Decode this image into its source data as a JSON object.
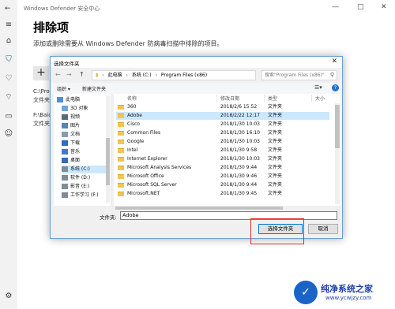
{
  "window": {
    "title": "Windows Defender 安全中心",
    "min": "—",
    "max": "□",
    "close": "✕"
  },
  "sidebar": {
    "icons": [
      "menu-icon",
      "home-icon",
      "shield-icon",
      "heart-icon",
      "wifi-icon",
      "browser-icon",
      "family-icon",
      "settings-icon"
    ],
    "active": "shield-icon"
  },
  "page": {
    "title": "排除项",
    "description": "添加或删除需要从 Windows Defender 防病毒扫描中排除的项目。",
    "add_symbol": "+",
    "exclusions": [
      "C:\\Prog",
      "文件夹",
      "F:\\Baid",
      "文件夹"
    ]
  },
  "dialog": {
    "title": "选择文件夹",
    "close": "✕",
    "nav": {
      "back": "←",
      "forward": "→",
      "up": "↑"
    },
    "address": [
      "此电脑",
      "系统 (C:)",
      "Program Files (x86)"
    ],
    "search_placeholder": "搜索\"Program Files (x86)\"",
    "toolbar": {
      "organize": "组织 ▾",
      "new_folder": "新建文件夹"
    },
    "tree": [
      {
        "label": "此电脑",
        "icon": "pc-icon",
        "selected": false
      },
      {
        "label": "3D 对象",
        "icon": "cube-icon",
        "selected": false
      },
      {
        "label": "视频",
        "icon": "video-icon",
        "selected": false
      },
      {
        "label": "图片",
        "icon": "pictures-icon",
        "selected": false
      },
      {
        "label": "文档",
        "icon": "documents-icon",
        "selected": false
      },
      {
        "label": "下载",
        "icon": "download-icon",
        "selected": false
      },
      {
        "label": "音乐",
        "icon": "music-icon",
        "selected": false
      },
      {
        "label": "桌面",
        "icon": "desktop-icon",
        "selected": false
      },
      {
        "label": "系统 (C:)",
        "icon": "drive-icon",
        "selected": true
      },
      {
        "label": "软件 (D:)",
        "icon": "drive-icon",
        "selected": false
      },
      {
        "label": "影音 (E:)",
        "icon": "drive-icon",
        "selected": false
      },
      {
        "label": "工作学习 (F:)",
        "icon": "drive-icon",
        "selected": false
      }
    ],
    "columns": {
      "name": "名称",
      "date": "修改日期",
      "type": "类型",
      "size": "大小"
    },
    "files": [
      {
        "name": "360",
        "date": "2018/2/6 15:52",
        "type": "文件夹",
        "selected": false
      },
      {
        "name": "Adobe",
        "date": "2018/2/22 12:17",
        "type": "文件夹",
        "selected": true
      },
      {
        "name": "Cisco",
        "date": "2018/1/30 10:03",
        "type": "文件夹",
        "selected": false
      },
      {
        "name": "Common Files",
        "date": "2018/1/30 16:10",
        "type": "文件夹",
        "selected": false
      },
      {
        "name": "Google",
        "date": "2018/1/30 10:03",
        "type": "文件夹",
        "selected": false
      },
      {
        "name": "Intel",
        "date": "2018/1/30 9:58",
        "type": "文件夹",
        "selected": false
      },
      {
        "name": "Internet Explorer",
        "date": "2018/1/30 10:03",
        "type": "文件夹",
        "selected": false
      },
      {
        "name": "Microsoft Analysis Services",
        "date": "2018/1/30 9:44",
        "type": "文件夹",
        "selected": false
      },
      {
        "name": "Microsoft Office",
        "date": "2018/1/30 9:46",
        "type": "文件夹",
        "selected": false
      },
      {
        "name": "Microsoft SQL Server",
        "date": "2018/1/30 9:44",
        "type": "文件夹",
        "selected": false
      },
      {
        "name": "Microsoft.NET",
        "date": "2018/1/30 9:45",
        "type": "文件夹",
        "selected": false
      }
    ],
    "filename_label": "文件夹:",
    "filename_value": "Adobe",
    "select_button": "选择文件夹",
    "cancel_button": "取消"
  },
  "watermark": {
    "title": "纯净系统之家",
    "url": "www.ycwjzy.com"
  }
}
